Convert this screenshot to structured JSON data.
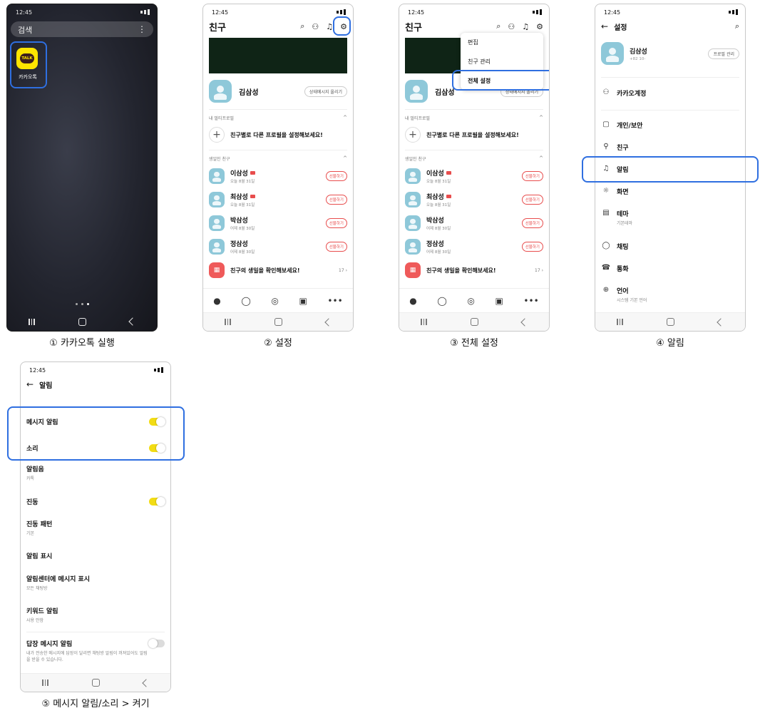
{
  "status_time": "12:45",
  "captions": [
    "① 카카오톡 실행",
    "② 설정",
    "③ 전체 설정",
    "④ 알림",
    "⑤ 메시지 알림/소리 > 켜기"
  ],
  "home": {
    "search_placeholder": "검색",
    "app_label": "카카오톡",
    "app_badge": "TALK"
  },
  "friends": {
    "title": "친구",
    "my_name": "김삼성",
    "status_button": "상태메시지 올리기",
    "multi_profile_label": "내 멀티프로필",
    "multi_profile_prompt": "친구별로 다른 프로필을 설정해보세요!",
    "birthday_label": "생일인 친구",
    "birthday_friends": [
      {
        "name": "이삼성",
        "date": "오늘 8월 31일",
        "gift": "선물하기"
      },
      {
        "name": "최삼성",
        "date": "오늘 8월 31일",
        "gift": "선물하기"
      },
      {
        "name": "박삼성",
        "date": "어제 8월 30일",
        "gift": "선물하기"
      },
      {
        "name": "정삼성",
        "date": "어제 8월 30일",
        "gift": "선물하기"
      }
    ],
    "birthday_check": "친구의 생일을 확인해보세요!",
    "birthday_count": "17",
    "menu": [
      "편집",
      "친구 관리",
      "전체 설정"
    ]
  },
  "settings": {
    "title": "설정",
    "profile_name": "김삼성",
    "profile_phone": "+82 10-",
    "profile_button": "프로필 관리",
    "items": [
      {
        "label": "카카오계정",
        "sub": ""
      },
      {
        "label": "개인/보안",
        "sub": ""
      },
      {
        "label": "친구",
        "sub": ""
      },
      {
        "label": "알림",
        "sub": ""
      },
      {
        "label": "화면",
        "sub": ""
      },
      {
        "label": "테마",
        "sub": "기본테마"
      },
      {
        "label": "채팅",
        "sub": ""
      },
      {
        "label": "통화",
        "sub": ""
      },
      {
        "label": "언어",
        "sub": "시스템 기본 언어"
      }
    ]
  },
  "alarm": {
    "title": "알림",
    "items": [
      {
        "label": "메시지 알림",
        "sub": "",
        "toggle": true
      },
      {
        "label": "소리",
        "sub": "",
        "toggle": true
      },
      {
        "label": "알림음",
        "sub": "카톡",
        "toggle": null
      },
      {
        "label": "진동",
        "sub": "",
        "toggle": true
      },
      {
        "label": "진동 패턴",
        "sub": "기본",
        "toggle": null
      },
      {
        "label": "알림 표시",
        "sub": "",
        "toggle": null
      },
      {
        "label": "알림센터에 메시지 표시",
        "sub": "모든 채팅방",
        "toggle": null
      },
      {
        "label": "키워드 알림",
        "sub": "사용 안함",
        "toggle": null
      },
      {
        "label": "답장 메시지 알림",
        "sub": "내가 전송한 메시지에 답장이 달리면 채팅방 알림이 꺼져있어도 알림을 받을 수 있습니다.",
        "toggle": false
      }
    ]
  },
  "colors": {
    "highlight": "#2f6fe0",
    "kakao_yellow": "#fee500",
    "toggle_on": "#f2dc14",
    "gift_red": "#e84d4d"
  }
}
